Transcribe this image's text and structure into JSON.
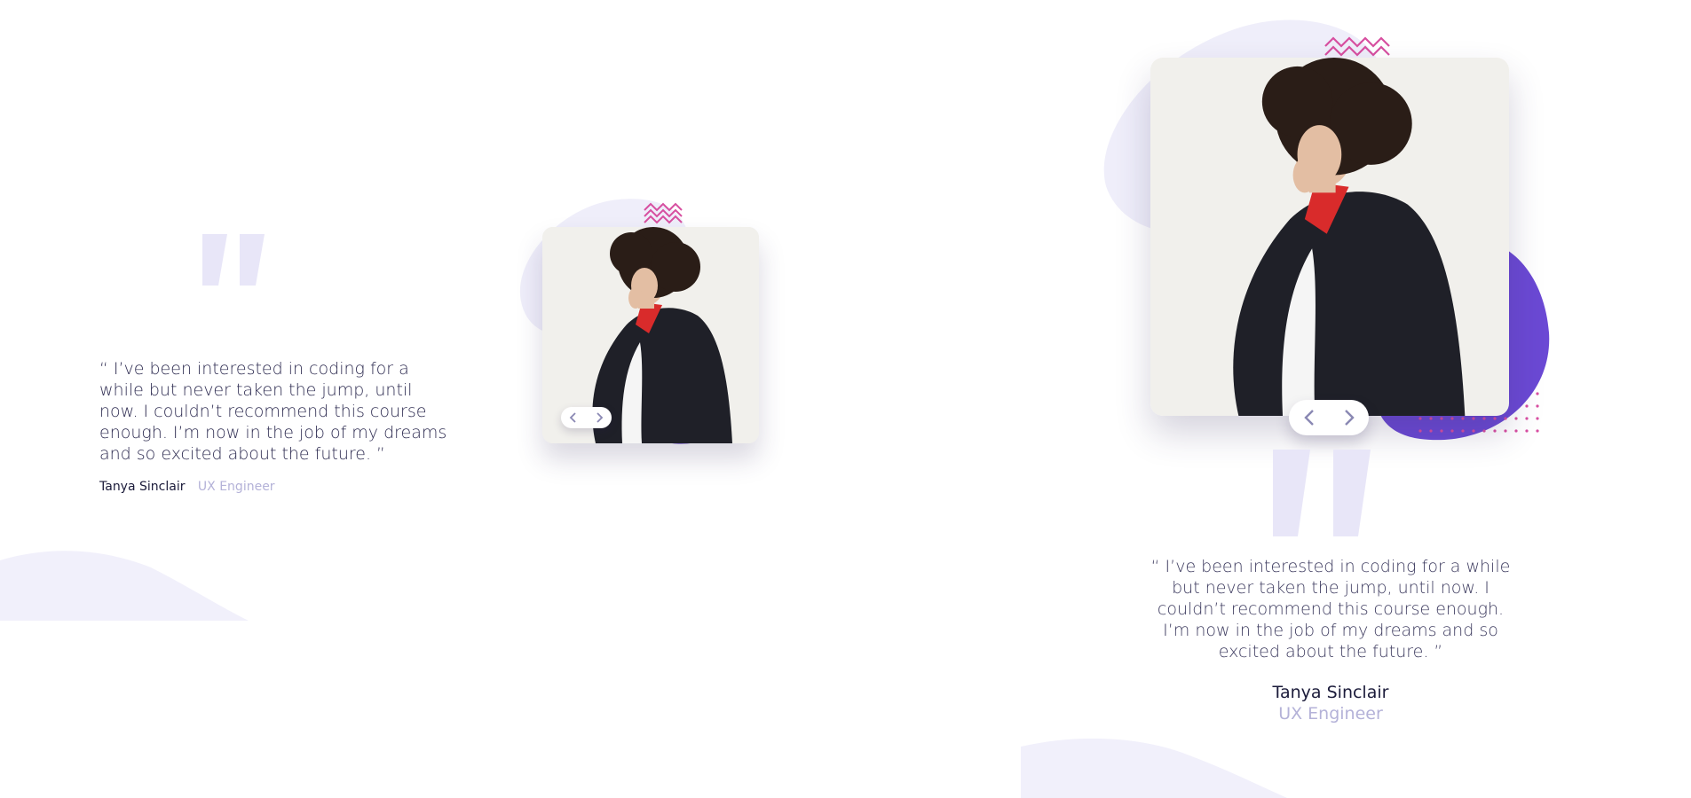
{
  "desktop": {
    "quote": "“ I’ve been interested in coding for a while but never taken the jump, until now. I couldn’t recommend this course enough. I’m now in the job of my dreams and so excited about the future. ”",
    "author_name": "Tanya Sinclair",
    "author_role": "UX Engineer"
  },
  "mobile": {
    "quote": "“ I’ve been interested in coding for a while but never taken the jump, until now. I couldn’t recommend this course enough. I’m now in the job of my dreams and so excited about the future. ”",
    "author_name": "Tanya Sinclair",
    "author_role": "UX Engineer"
  },
  "icons": {
    "prev": "chevron-left-icon",
    "next": "chevron-right-icon",
    "quote": "quote-mark-icon",
    "zigzag": "zigzag-pattern-icon"
  },
  "colors": {
    "accent_purple": "#6c48d8",
    "pale_purple": "#e9e7fb",
    "pink": "#d74fa0",
    "text_dark": "#202040",
    "text_muted": "#b4b2d8"
  }
}
